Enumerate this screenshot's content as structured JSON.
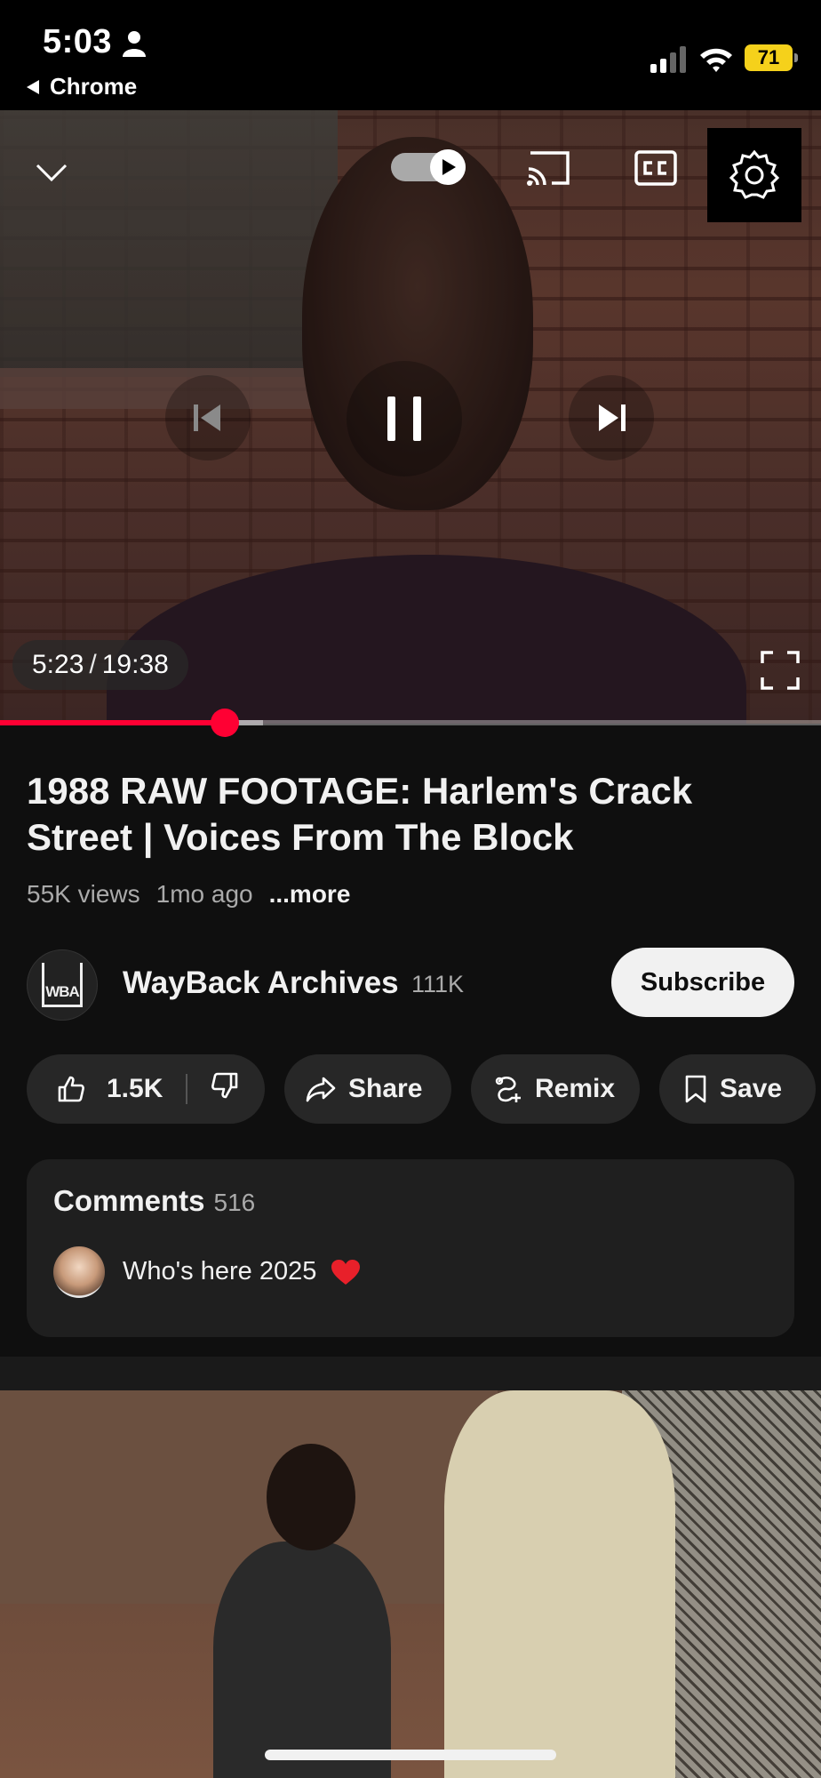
{
  "status_bar": {
    "time": "5:03",
    "back_app": "Chrome",
    "battery": "71"
  },
  "player": {
    "current_time": "5:23",
    "separator": "/",
    "duration": "19:38",
    "progress_fraction": 0.2735,
    "buffered_fraction": 0.32,
    "settings_watermark": "WBA",
    "accent_color": "#ff0033"
  },
  "video": {
    "title": "1988 RAW FOOTAGE: Harlem's Crack Street | Voices From The Block",
    "views": "55K views",
    "age": "1mo ago",
    "more_label": "...more"
  },
  "channel": {
    "avatar_text": "WBA",
    "name": "WayBack Archives",
    "subscribers": "111K",
    "subscribe_label": "Subscribe"
  },
  "actions": {
    "like_count": "1.5K",
    "share_label": "Share",
    "remix_label": "Remix",
    "save_label": "Save"
  },
  "comments": {
    "heading": "Comments",
    "count": "516",
    "top_comment": "Who's here 2025"
  },
  "icons": [
    "chevron-down-icon",
    "autoplay-toggle-icon",
    "cast-icon",
    "captions-icon",
    "settings-icon",
    "previous-icon",
    "pause-icon",
    "next-icon",
    "fullscreen-icon",
    "like-icon",
    "dislike-icon",
    "share-icon",
    "remix-icon",
    "bookmark-icon",
    "heart-icon"
  ]
}
